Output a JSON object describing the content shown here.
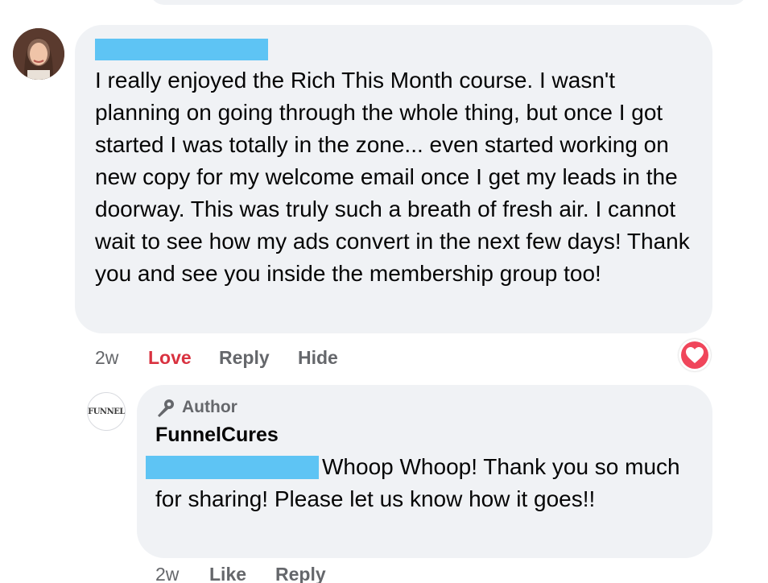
{
  "comment": {
    "author_redacted": true,
    "text": "I really enjoyed the Rich This Month course. I wasn't planning on going through the whole thing, but once I got started I was totally in the zone... even started working on new copy for my welcome email once I get my leads in the doorway. This was truly such a breath of fresh air. I cannot wait to see how my ads convert in the next few days! Thank you and see you inside the membership group too!",
    "actions": {
      "time": "2w",
      "love": "Love",
      "reply": "Reply",
      "hide": "Hide"
    },
    "reaction_icon": "heart-icon",
    "reaction_color": "#f0465b",
    "love_color": "#d93240"
  },
  "reply": {
    "author_badge": "Author",
    "author_badge_icon": "microphone-icon",
    "name": "FunnelCures",
    "avatar_text": "FUNNEL",
    "mention_redacted": true,
    "text": "Whoop Whoop! Thank you so much for sharing! Please let us know how it goes!!",
    "actions": {
      "time": "2w",
      "like": "Like",
      "reply": "Reply"
    }
  },
  "colors": {
    "bubble_bg": "#f0f2f5",
    "redaction": "#5ec4f4",
    "secondary_text": "#65676b"
  }
}
